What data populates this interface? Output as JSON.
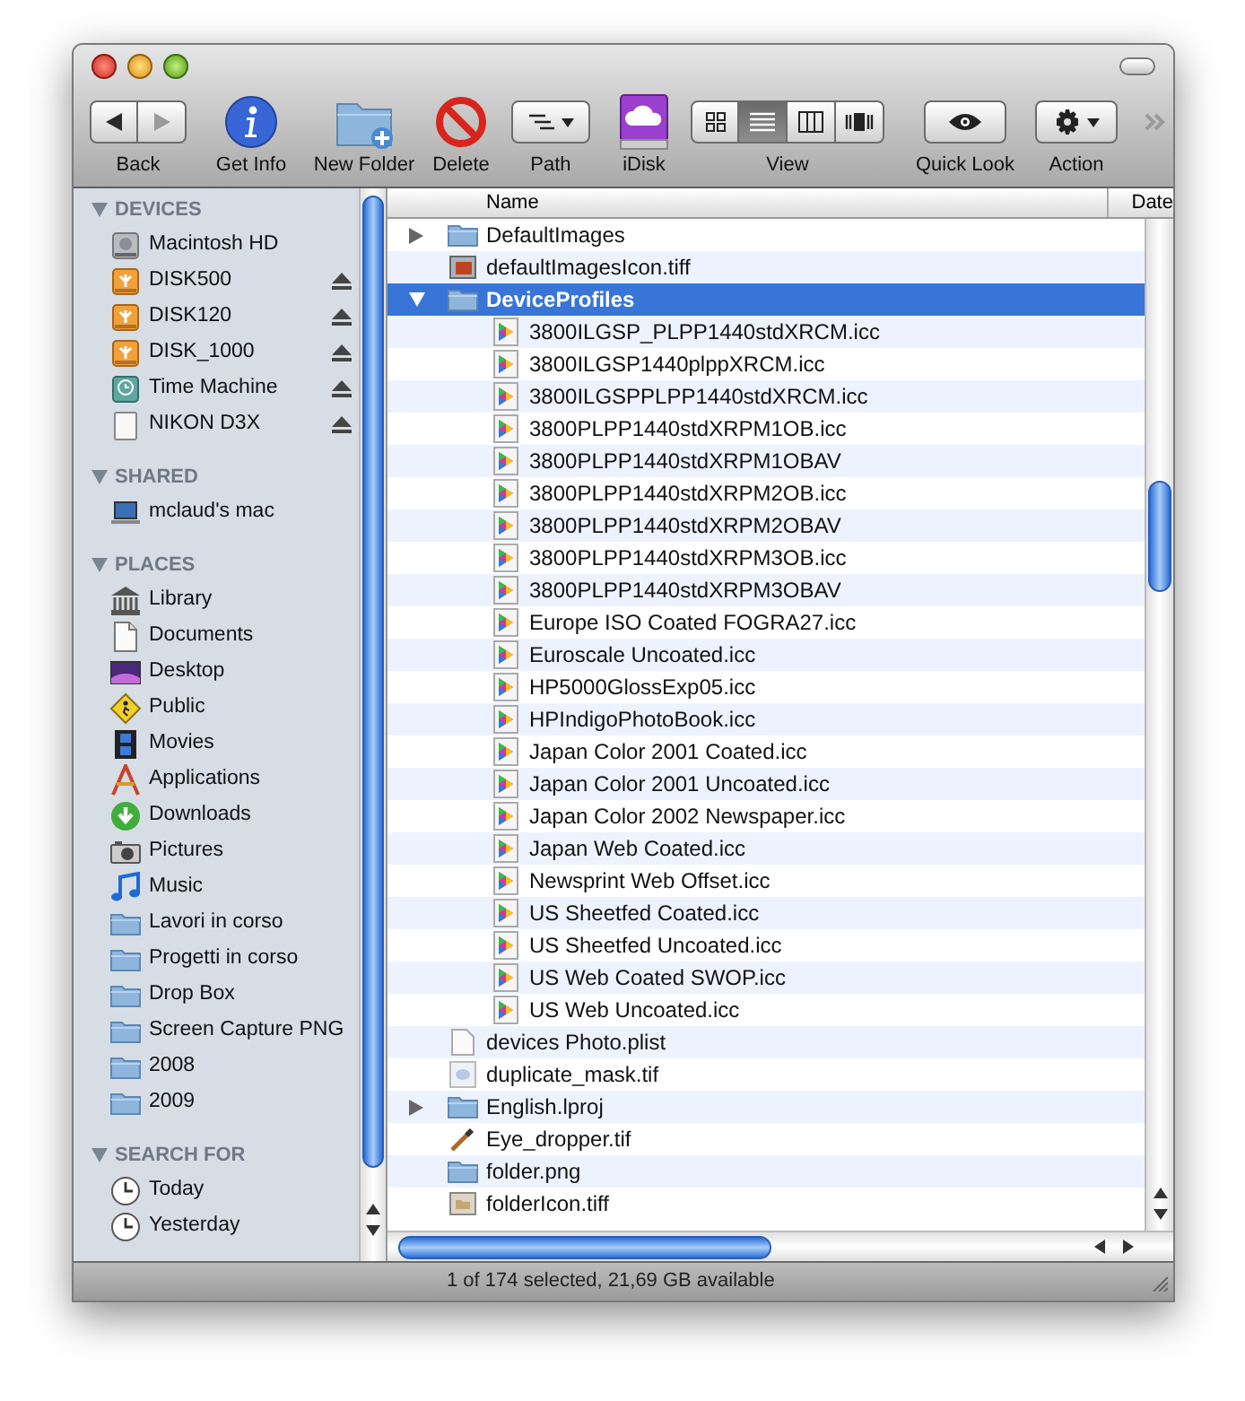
{
  "toolbar": {
    "items": [
      {
        "kind": "nav",
        "label": "Back",
        "segments": [
          {
            "kind": "back",
            "disabled": false
          },
          {
            "kind": "forward",
            "disabled": true
          }
        ]
      },
      {
        "kind": "info",
        "label": "Get Info"
      },
      {
        "kind": "new-folder",
        "label": "New Folder"
      },
      {
        "kind": "delete",
        "label": "Delete"
      },
      {
        "kind": "path",
        "label": "Path"
      },
      {
        "kind": "idisk",
        "label": "iDisk"
      },
      {
        "kind": "view",
        "label": "View",
        "segments": [
          {
            "kind": "icons",
            "selected": false
          },
          {
            "kind": "list",
            "selected": true
          },
          {
            "kind": "columns",
            "selected": false
          },
          {
            "kind": "coverflow",
            "selected": false
          }
        ]
      },
      {
        "kind": "quicklook",
        "label": "Quick Look"
      },
      {
        "kind": "action",
        "label": "Action"
      }
    ]
  },
  "sidebar": {
    "sections": [
      {
        "title": "DEVICES",
        "expanded": true,
        "items": [
          {
            "label": "Macintosh HD",
            "kind": "hd",
            "eject": false
          },
          {
            "label": "DISK500",
            "kind": "disk",
            "eject": true
          },
          {
            "label": "DISK120",
            "kind": "disk",
            "eject": true
          },
          {
            "label": "DISK_1000",
            "kind": "disk",
            "eject": true
          },
          {
            "label": "Time Machine",
            "kind": "timemachine",
            "eject": true
          },
          {
            "label": "NIKON D3X",
            "kind": "card",
            "eject": true
          }
        ]
      },
      {
        "title": "SHARED",
        "expanded": true,
        "items": [
          {
            "label": "mclaud's mac",
            "kind": "computer",
            "eject": false
          }
        ]
      },
      {
        "title": "PLACES",
        "expanded": true,
        "items": [
          {
            "label": "Library",
            "kind": "library",
            "eject": false
          },
          {
            "label": "Documents",
            "kind": "documents",
            "eject": false
          },
          {
            "label": "Desktop",
            "kind": "desktop",
            "eject": false
          },
          {
            "label": "Public",
            "kind": "public",
            "eject": false
          },
          {
            "label": "Movies",
            "kind": "movies",
            "eject": false
          },
          {
            "label": "Applications",
            "kind": "applications",
            "eject": false
          },
          {
            "label": "Downloads",
            "kind": "downloads",
            "eject": false
          },
          {
            "label": "Pictures",
            "kind": "pictures",
            "eject": false
          },
          {
            "label": "Music",
            "kind": "music",
            "eject": false
          },
          {
            "label": "Lavori in corso",
            "kind": "folder",
            "eject": false
          },
          {
            "label": "Progetti in corso",
            "kind": "folder",
            "eject": false
          },
          {
            "label": "Drop Box",
            "kind": "folder",
            "eject": false
          },
          {
            "label": "Screen Capture PNG",
            "kind": "folder",
            "eject": false
          },
          {
            "label": "2008",
            "kind": "folder",
            "eject": false
          },
          {
            "label": "2009",
            "kind": "folder",
            "eject": false
          }
        ]
      },
      {
        "title": "SEARCH FOR",
        "expanded": true,
        "items": [
          {
            "label": "Today",
            "kind": "clock",
            "eject": false
          },
          {
            "label": "Yesterday",
            "kind": "clock",
            "eject": false
          }
        ]
      }
    ]
  },
  "files": {
    "columns": [
      "Name",
      "Date"
    ],
    "rows": [
      {
        "name": "DefaultImages",
        "kind": "folder",
        "expanded": false,
        "selected": false
      },
      {
        "name": "defaultImagesIcon.tiff",
        "kind": "image",
        "selected": false
      },
      {
        "name": "DeviceProfiles",
        "kind": "folder",
        "expanded": true,
        "selected": true,
        "children": [
          {
            "name": "3800ILGSP_PLPP1440stdXRCM.icc",
            "kind": "profile",
            "selected": false
          },
          {
            "name": "3800ILGSP1440plppXRCM.icc",
            "kind": "profile",
            "selected": false
          },
          {
            "name": "3800ILGSPPLPP1440stdXRCM.icc",
            "kind": "profile",
            "selected": false
          },
          {
            "name": "3800PLPP1440stdXRPM1OB.icc",
            "kind": "profile",
            "selected": false
          },
          {
            "name": "3800PLPP1440stdXRPM1OBAV",
            "kind": "profile",
            "selected": false
          },
          {
            "name": "3800PLPP1440stdXRPM2OB.icc",
            "kind": "profile",
            "selected": false
          },
          {
            "name": "3800PLPP1440stdXRPM2OBAV",
            "kind": "profile",
            "selected": false
          },
          {
            "name": "3800PLPP1440stdXRPM3OB.icc",
            "kind": "profile",
            "selected": false
          },
          {
            "name": "3800PLPP1440stdXRPM3OBAV",
            "kind": "profile",
            "selected": false
          },
          {
            "name": "Europe ISO Coated FOGRA27.icc",
            "kind": "profile",
            "selected": false
          },
          {
            "name": "Euroscale Uncoated.icc",
            "kind": "profile",
            "selected": false
          },
          {
            "name": "HP5000GlossExp05.icc",
            "kind": "profile",
            "selected": false
          },
          {
            "name": "HPIndigoPhotoBook.icc",
            "kind": "profile",
            "selected": false
          },
          {
            "name": "Japan Color 2001 Coated.icc",
            "kind": "profile",
            "selected": false
          },
          {
            "name": "Japan Color 2001 Uncoated.icc",
            "kind": "profile",
            "selected": false
          },
          {
            "name": "Japan Color 2002 Newspaper.icc",
            "kind": "profile",
            "selected": false
          },
          {
            "name": "Japan Web Coated.icc",
            "kind": "profile",
            "selected": false
          },
          {
            "name": "Newsprint Web Offset.icc",
            "kind": "profile",
            "selected": false
          },
          {
            "name": "US Sheetfed Coated.icc",
            "kind": "profile",
            "selected": false
          },
          {
            "name": "US Sheetfed Uncoated.icc",
            "kind": "profile",
            "selected": false
          },
          {
            "name": "US Web Coated SWOP.icc",
            "kind": "profile",
            "selected": false
          },
          {
            "name": "US Web Uncoated.icc",
            "kind": "profile",
            "selected": false
          }
        ]
      },
      {
        "name": "devices Photo.plist",
        "kind": "document",
        "selected": false
      },
      {
        "name": "duplicate_mask.tif",
        "kind": "mask",
        "selected": false
      },
      {
        "name": "English.lproj",
        "kind": "folder",
        "expanded": false,
        "selected": false
      },
      {
        "name": "Eye_dropper.tif",
        "kind": "dropper",
        "selected": false
      },
      {
        "name": "folder.png",
        "kind": "folder",
        "selected": false
      },
      {
        "name": "folderIcon.tiff",
        "kind": "tiff",
        "selected": false
      }
    ]
  },
  "status_bar": "1 of 174 selected, 21,69 GB available"
}
